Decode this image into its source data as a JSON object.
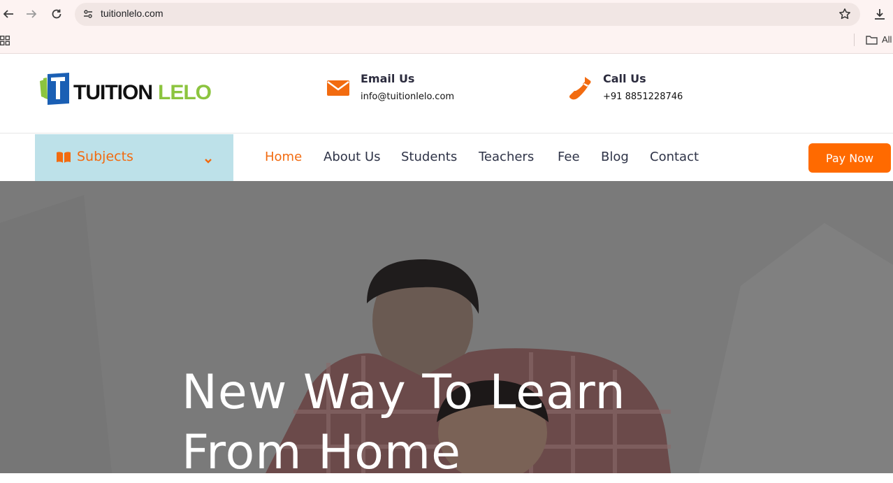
{
  "browser": {
    "url": "tuitionlelo.com",
    "bookmarks_label": "All"
  },
  "header": {
    "logo": {
      "word1": "TUITION",
      "word2": "LELO"
    },
    "email": {
      "title": "Email Us",
      "value": "info@tuitionlelo.com",
      "icon": "envelope-icon"
    },
    "phone": {
      "title": "Call Us",
      "value": "+91 8851228746",
      "icon": "phone-icon"
    }
  },
  "nav": {
    "subjects_label": "Subjects",
    "items": [
      {
        "label": "Home",
        "active": true
      },
      {
        "label": "About Us"
      },
      {
        "label": "Students"
      },
      {
        "label": "Teachers"
      },
      {
        "label": "Fee"
      },
      {
        "label": "Blog"
      },
      {
        "label": "Contact"
      }
    ],
    "pay_button": "Pay Now"
  },
  "hero": {
    "line1": "New Way To Learn",
    "line2": "From Home"
  },
  "colors": {
    "accent": "#f26b10",
    "button": "#ff6a00",
    "subjects_bg": "#bde1e9",
    "logo_green": "#8cc43f",
    "logo_blue": "#1a5fb4"
  }
}
